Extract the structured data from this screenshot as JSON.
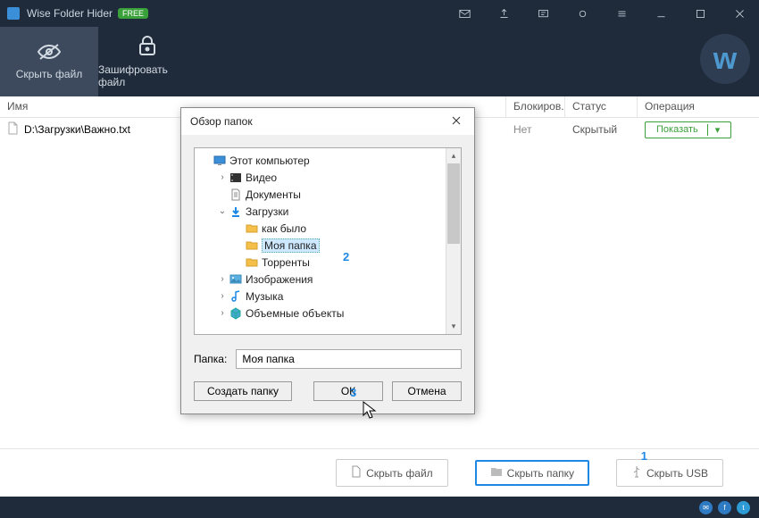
{
  "app": {
    "title": "Wise Folder Hider",
    "badge": "FREE"
  },
  "toolbar": {
    "hide_file": "Скрыть файл",
    "encrypt_file": "Зашифровать файл"
  },
  "columns": {
    "name": "Имя",
    "lock": "Блокиров...",
    "status": "Статус",
    "operation": "Операция"
  },
  "list": {
    "items": [
      {
        "path": "D:\\Загрузки\\Важно.txt",
        "lock": "Нет",
        "status": "Скрытый",
        "action": "Показать"
      }
    ]
  },
  "bottom": {
    "hide_file": "Скрыть файл",
    "hide_folder": "Скрыть папку",
    "hide_usb": "Скрыть USB"
  },
  "annotations": {
    "n1": "1",
    "n2": "2",
    "n3": "3"
  },
  "dialog": {
    "title": "Обзор папок",
    "folder_label": "Папка:",
    "folder_value": "Моя папка",
    "create": "Создать папку",
    "ok": "ОК",
    "cancel": "Отмена",
    "tree": [
      {
        "indent": 0,
        "expand": "",
        "icon": "pc",
        "label": "Этот компьютер",
        "selected": false
      },
      {
        "indent": 1,
        "expand": "›",
        "icon": "video",
        "label": "Видео",
        "selected": false
      },
      {
        "indent": 1,
        "expand": "",
        "icon": "doc",
        "label": "Документы",
        "selected": false
      },
      {
        "indent": 1,
        "expand": "⌄",
        "icon": "down",
        "label": "Загрузки",
        "selected": false
      },
      {
        "indent": 2,
        "expand": "",
        "icon": "folder",
        "label": "как было",
        "selected": false
      },
      {
        "indent": 2,
        "expand": "",
        "icon": "folder",
        "label": "Моя папка",
        "selected": true
      },
      {
        "indent": 2,
        "expand": "",
        "icon": "folder",
        "label": "Торренты",
        "selected": false
      },
      {
        "indent": 1,
        "expand": "›",
        "icon": "image",
        "label": "Изображения",
        "selected": false
      },
      {
        "indent": 1,
        "expand": "›",
        "icon": "music",
        "label": "Музыка",
        "selected": false
      },
      {
        "indent": 1,
        "expand": "›",
        "icon": "cube",
        "label": "Объемные объекты",
        "selected": false
      }
    ]
  }
}
